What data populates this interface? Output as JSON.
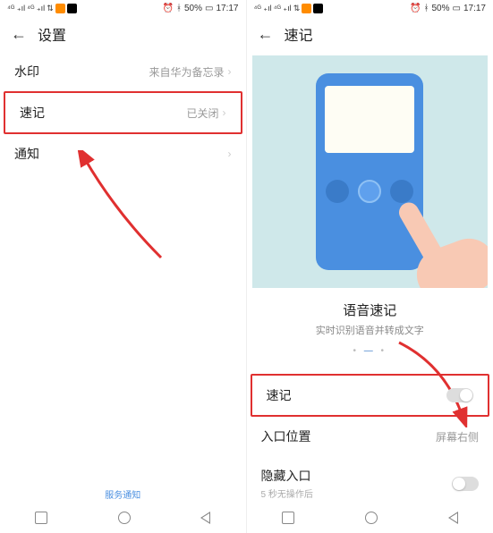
{
  "left": {
    "status": {
      "battery": "50%",
      "time": "17:17"
    },
    "header": {
      "title": "设置"
    },
    "rows": {
      "watermark": {
        "label": "水印",
        "value": "来自华为备忘录"
      },
      "quicknote": {
        "label": "速记",
        "value": "已关闭"
      },
      "notify": {
        "label": "通知"
      }
    },
    "footer_link": "服务通知"
  },
  "right": {
    "status": {
      "battery": "50%",
      "time": "17:17"
    },
    "header": {
      "title": "速记"
    },
    "promo": {
      "title": "语音速记",
      "subtitle": "实时识别语音并转成文字"
    },
    "rows": {
      "quicknote": {
        "label": "速记"
      },
      "position": {
        "label": "入口位置",
        "value": "屏幕右侧"
      },
      "hide": {
        "label": "隐藏入口",
        "sub": "5 秒无操作后"
      }
    }
  }
}
